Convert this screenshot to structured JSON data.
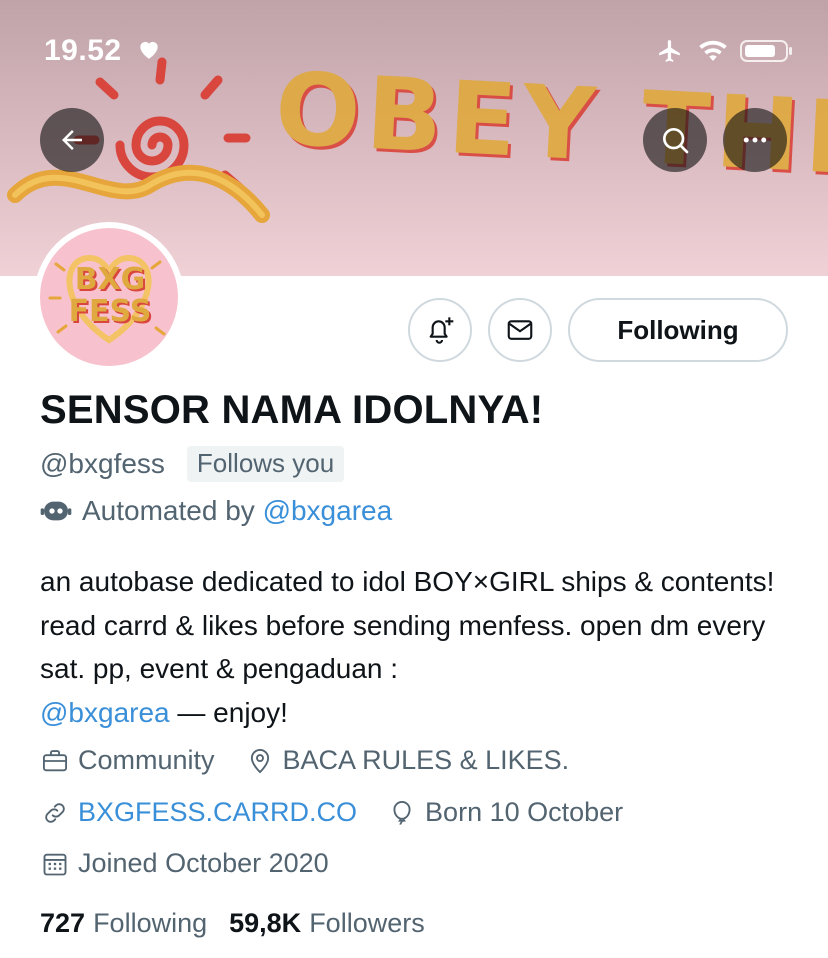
{
  "status_bar": {
    "time": "19.52",
    "icons": [
      "heart-icon",
      "airplane-icon",
      "wifi-icon",
      "battery-icon"
    ]
  },
  "header": {
    "back_icon": "arrow-left-icon",
    "search_icon": "search-icon",
    "more_icon": "more-dots-icon",
    "banner_text": "OBEY THE RULES"
  },
  "avatar": {
    "text": "BXG FESS"
  },
  "actions": {
    "notify_icon": "bell-plus-icon",
    "message_icon": "envelope-icon",
    "following_label": "Following"
  },
  "profile": {
    "display_name": "SENSOR NAMA IDOLNYA!",
    "handle": "@bxgfess",
    "follows_you": "Follows you",
    "automated_prefix": "Automated by",
    "automated_handle": "@bxgarea",
    "bio_text": "an autobase dedicated to idol BOY×GIRL ships & contents! read carrd & likes before sending menfess. open dm every sat. pp, event & pengaduan :",
    "bio_mention": "@bxgarea",
    "bio_suffix": "— enjoy!",
    "category": "Community",
    "location": "BACA RULES & LIKES.",
    "website": "BXGFESS.CARRD.CO",
    "birthday": "Born 10 October",
    "joined": "Joined October 2020"
  },
  "stats": {
    "following_count": "727",
    "following_label": "Following",
    "followers_count": "59,8K",
    "followers_label": "Followers"
  },
  "colors": {
    "link": "#3a8fd9",
    "secondary_text": "#536471",
    "primary_text": "#0f1419",
    "border": "#cfd9de",
    "banner_pink": "#efd1d6"
  }
}
